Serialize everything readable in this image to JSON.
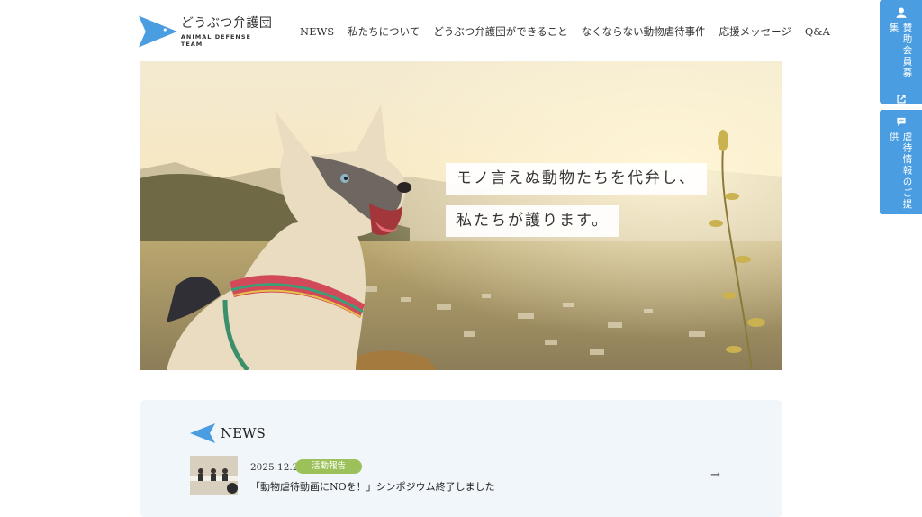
{
  "brand": {
    "name_ja": "どうぶつ弁護団",
    "name_en": "ANIMAL DEFENSE TEAM",
    "color": "#4a9de0"
  },
  "nav": [
    {
      "label": "NEWS"
    },
    {
      "label": "私たちについて"
    },
    {
      "label": "どうぶつ弁護団ができること"
    },
    {
      "label": "なくならない動物虐待事件"
    },
    {
      "label": "応援メッセージ"
    },
    {
      "label": "Q&A"
    }
  ],
  "side_tabs": [
    {
      "label": "賛助会員募集",
      "icon": "person-icon",
      "icon2": "external-link-icon"
    },
    {
      "label": "虐待情報のご提供",
      "icon": "chat-icon"
    }
  ],
  "hero": {
    "catch_line1": "モノ言えぬ動物たちを代弁し、",
    "catch_line2": "私たちが護ります。"
  },
  "news": {
    "heading": "NEWS",
    "items": [
      {
        "date": "2025.12.21",
        "category": "活動報告",
        "category_color": "#9cc15a",
        "title": "「動物虐待動画にNOを！」シンポジウム終了しました",
        "arrow": "→"
      }
    ]
  }
}
